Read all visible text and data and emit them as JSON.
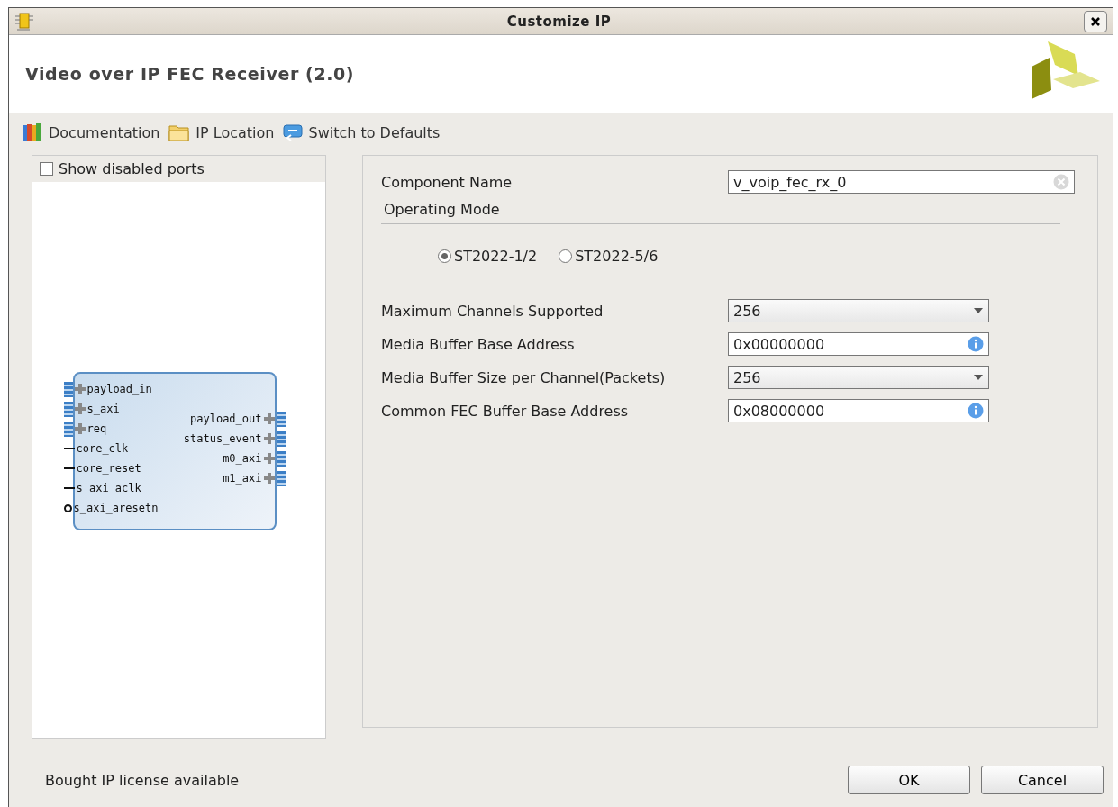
{
  "window": {
    "title": "Customize IP"
  },
  "header": {
    "title": "Video over IP FEC Receiver (2.0)"
  },
  "toolbar": [
    {
      "kind": "docs",
      "label": "Documentation"
    },
    {
      "kind": "folder",
      "label": "IP Location"
    },
    {
      "kind": "reset",
      "label": "Switch to Defaults"
    }
  ],
  "symbol_panel": {
    "show_disabled_ports": {
      "label": "Show disabled ports",
      "checked": false
    },
    "left_ports": [
      {
        "kind": "bus",
        "name": "payload_in"
      },
      {
        "kind": "bus",
        "name": "s_axi"
      },
      {
        "kind": "bus",
        "name": "req"
      },
      {
        "kind": "wire",
        "name": "core_clk"
      },
      {
        "kind": "wire",
        "name": "core_reset"
      },
      {
        "kind": "wire",
        "name": "s_axi_aclk"
      },
      {
        "kind": "reset",
        "name": "s_axi_aresetn"
      }
    ],
    "right_ports": [
      {
        "name": "payload_out"
      },
      {
        "name": "status_event"
      },
      {
        "name": "m0_axi"
      },
      {
        "name": "m1_axi"
      }
    ]
  },
  "form": {
    "component_name": {
      "label": "Component Name",
      "value": "v_voip_fec_rx_0"
    },
    "operating_mode": {
      "title": "Operating Mode",
      "options": [
        {
          "label": "ST2022-1/2",
          "selected": true
        },
        {
          "label": "ST2022-5/6",
          "selected": false
        }
      ]
    },
    "params": [
      {
        "kind": "dropdown",
        "label": "Maximum Channels Supported",
        "value": "256"
      },
      {
        "kind": "text",
        "label": "Media Buffer Base Address",
        "value": "0x00000000"
      },
      {
        "kind": "dropdown",
        "label": "Media Buffer Size per Channel(Packets)",
        "value": "256"
      },
      {
        "kind": "text",
        "label": "Common FEC Buffer Base Address",
        "value": "0x08000000"
      }
    ]
  },
  "footer": {
    "status": "Bought IP license available",
    "buttons": [
      "OK",
      "Cancel"
    ]
  }
}
